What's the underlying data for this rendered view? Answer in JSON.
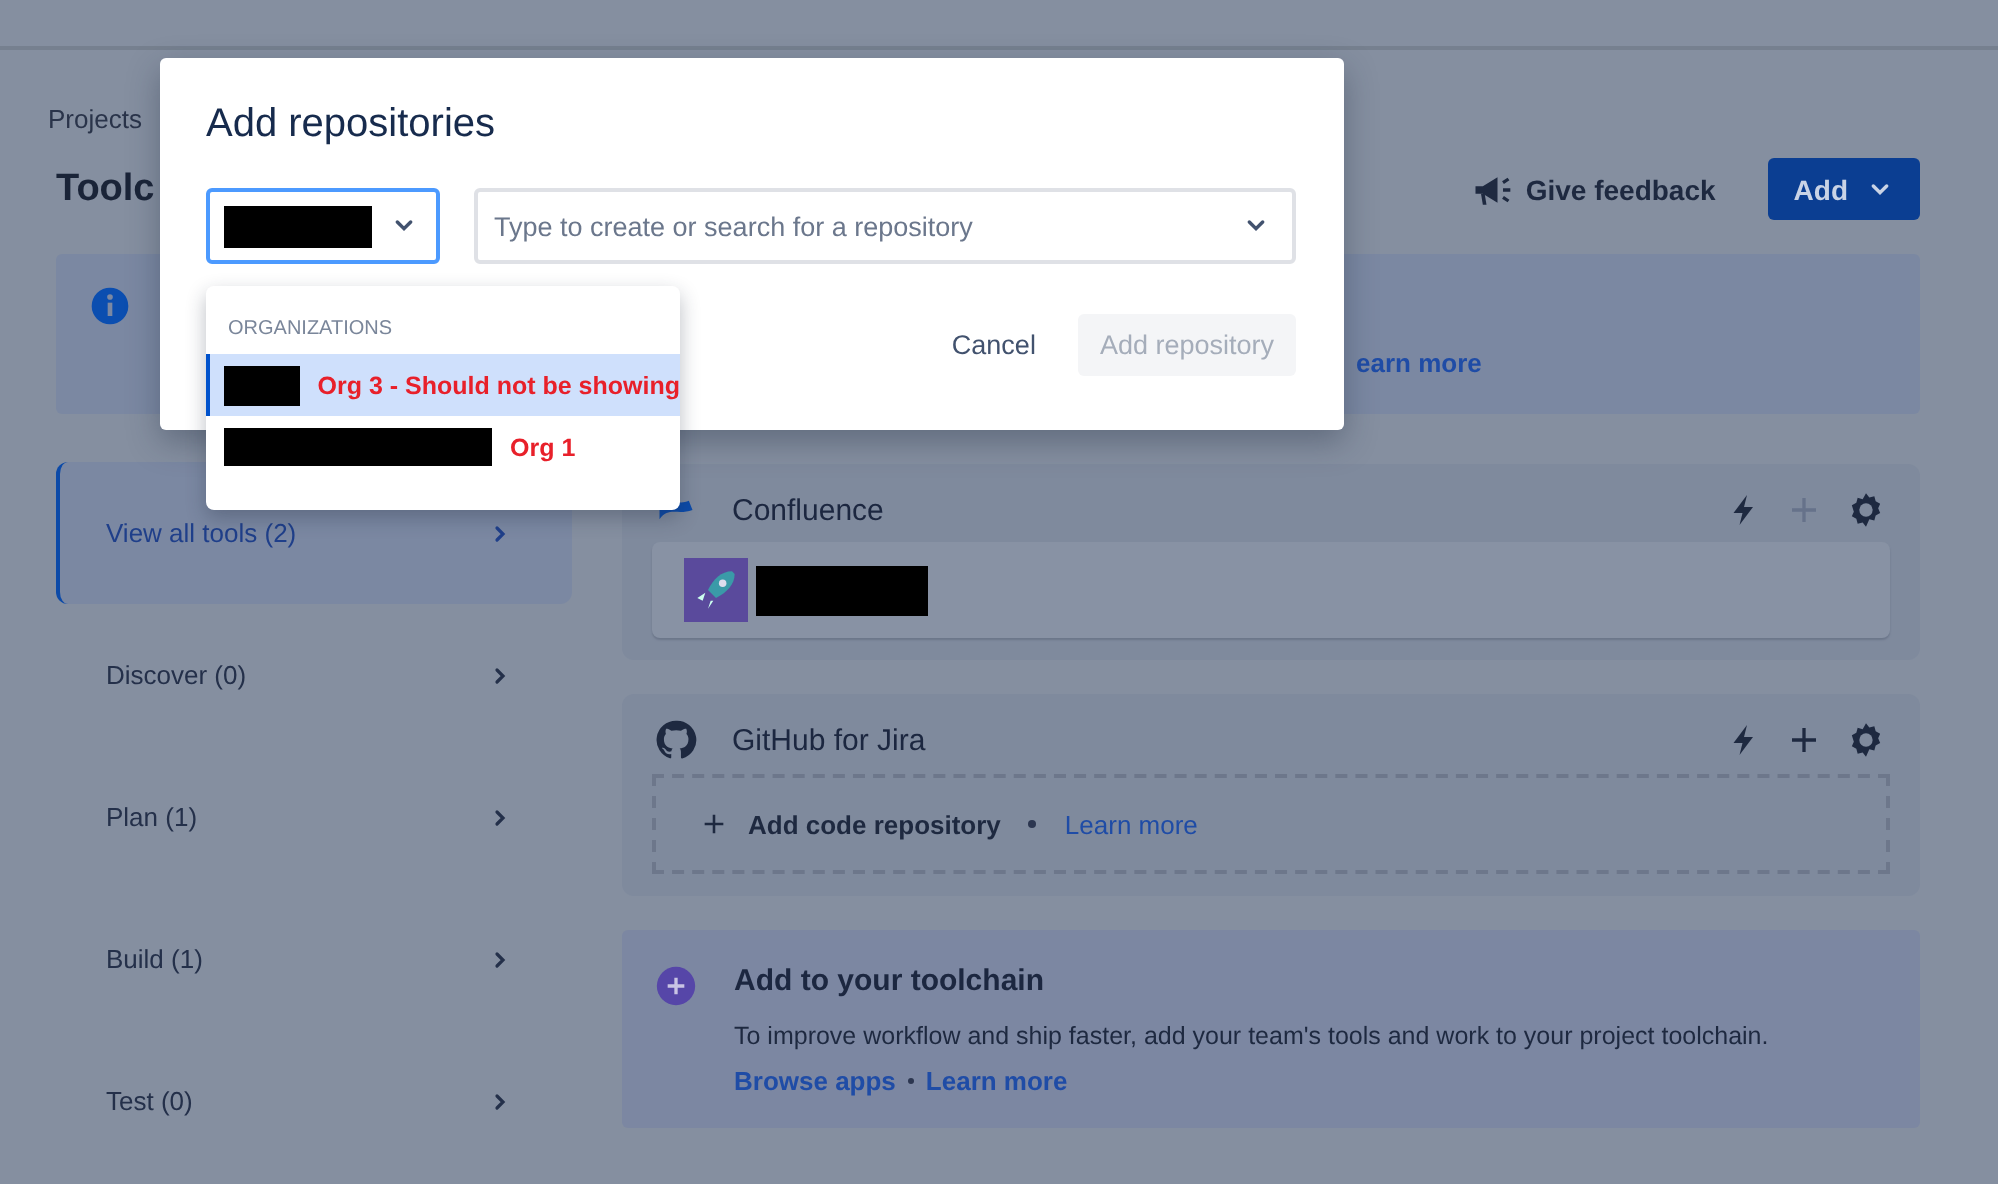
{
  "breadcrumb": "Projects",
  "page_title": "Toolc",
  "header_actions": {
    "feedback": "Give feedback",
    "add": "Add"
  },
  "info_banner": {
    "link": "earn more"
  },
  "sidebar": {
    "items": [
      {
        "label": "View all tools (2)",
        "selected": true
      },
      {
        "label": "Discover (0)",
        "selected": false
      },
      {
        "label": "Plan (1)",
        "selected": false
      },
      {
        "label": "Build (1)",
        "selected": false
      },
      {
        "label": "Test (0)",
        "selected": false
      }
    ]
  },
  "tools": [
    {
      "kind": "linked",
      "name": "Confluence",
      "add_disabled": true
    },
    {
      "kind": "empty",
      "name": "GitHub for Jira",
      "add_disabled": false,
      "add_label": "Add code repository",
      "link": "Learn more"
    }
  ],
  "toolchain": {
    "title": "Add to your toolchain",
    "description": "To improve workflow and ship faster, add your team's tools and work to your project toolchain.",
    "links": [
      "Browse apps",
      "Learn more"
    ]
  },
  "modal": {
    "title": "Add repositories",
    "org_select": {
      "focused": true
    },
    "repo_select": {
      "placeholder": "Type to create or search for a repository"
    },
    "buttons": [
      {
        "label": "Cancel",
        "disabled": false
      },
      {
        "label": "Add repository",
        "disabled": true
      }
    ]
  },
  "org_menu": {
    "group": "ORGANIZATIONS",
    "items": [
      {
        "annotation": "Org 3 - Should not be showing",
        "selected": true
      },
      {
        "annotation": "Org 1",
        "selected": false
      }
    ]
  }
}
